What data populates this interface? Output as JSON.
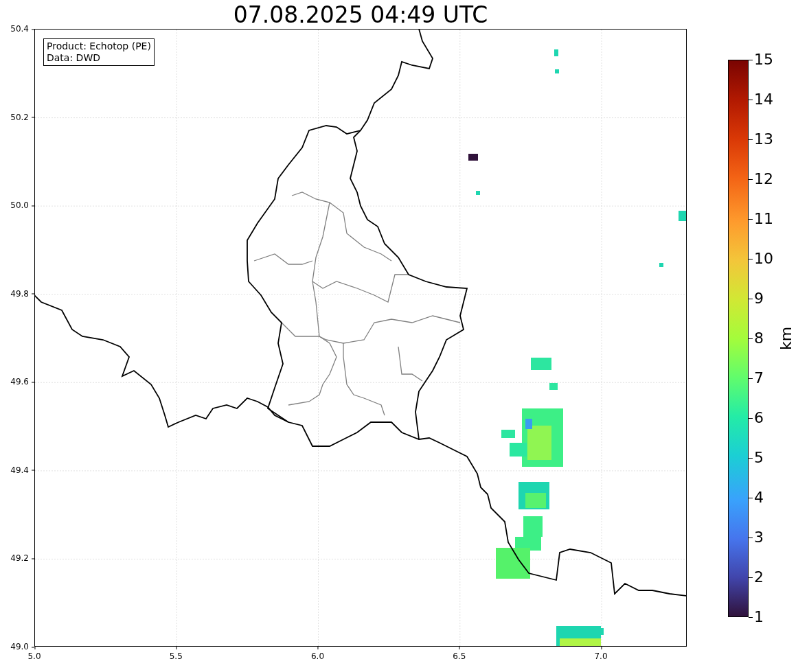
{
  "title": "07.08.2025 04:49 UTC",
  "info_box": [
    "Product: Echotop (PE)",
    "Data: DWD"
  ],
  "x_ticks": [
    "5.0",
    "5.5",
    "6.0",
    "6.5",
    "7.0"
  ],
  "y_ticks": [
    "50.4",
    "50.2",
    "50.0",
    "49.8",
    "49.6",
    "49.4",
    "49.2",
    "49.0"
  ],
  "colorbar": {
    "label": "km",
    "ticks": [
      "15",
      "14",
      "13",
      "12",
      "11",
      "10",
      "9",
      "8",
      "7",
      "6",
      "5",
      "4",
      "3",
      "2",
      "1"
    ]
  }
}
